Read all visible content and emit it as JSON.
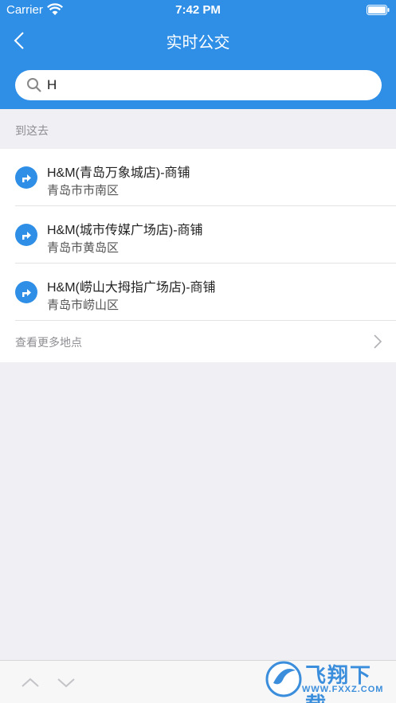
{
  "status_bar": {
    "carrier": "Carrier",
    "time": "7:42 PM"
  },
  "nav": {
    "title": "实时公交",
    "back_icon": "chevron-left-icon"
  },
  "search": {
    "value": "H",
    "placeholder": ""
  },
  "section": {
    "label": "到这去"
  },
  "results": [
    {
      "title": "H&M(青岛万象城店)-商铺",
      "subtitle": "青岛市市南区"
    },
    {
      "title": "H&M(城市传媒广场店)-商铺",
      "subtitle": "青岛市黄岛区"
    },
    {
      "title": "H&M(崂山大拇指广场店)-商铺",
      "subtitle": "青岛市崂山区"
    }
  ],
  "more": {
    "label": "查看更多地点"
  },
  "watermark": {
    "text": "飞翔下载",
    "url": "WWW.FXXZ.COM"
  },
  "colors": {
    "accent": "#2f8fe6",
    "background": "#efeff4"
  }
}
